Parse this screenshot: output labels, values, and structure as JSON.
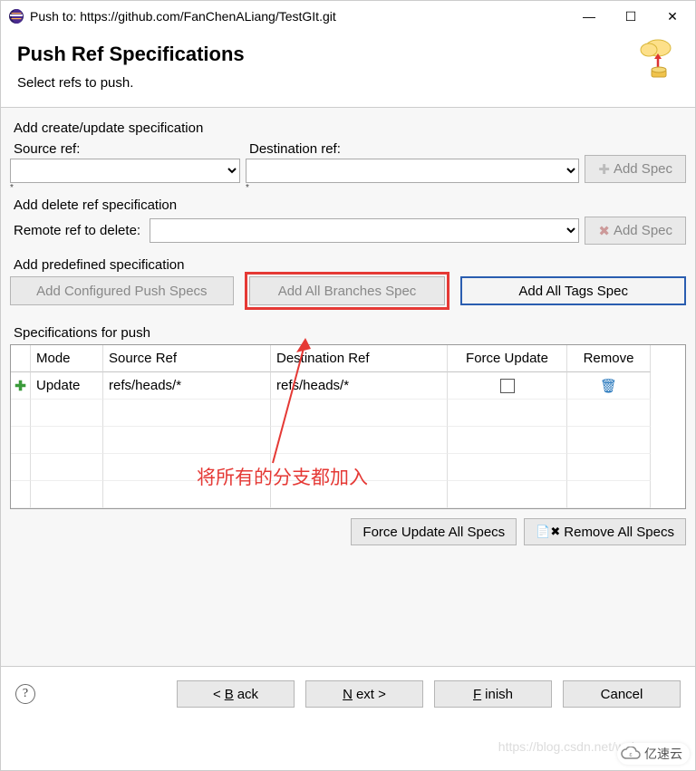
{
  "window": {
    "title": "Push to: https://github.com/FanChenALiang/TestGIt.git"
  },
  "header": {
    "title": "Push Ref Specifications",
    "subtitle": "Select refs to push."
  },
  "sections": {
    "create_update": {
      "label": "Add create/update specification",
      "source_label": "Source ref:",
      "dest_label": "Destination ref:",
      "source_value": "",
      "dest_value": "",
      "add_btn": "Add Spec"
    },
    "delete": {
      "label": "Add delete ref specification",
      "remote_label": "Remote ref to delete:",
      "remote_value": "",
      "add_btn": "Add Spec"
    },
    "predefined": {
      "label": "Add predefined specification",
      "configured_btn": "Add Configured Push Specs",
      "all_branches_btn": "Add All Branches Spec",
      "all_tags_btn": "Add All Tags Spec"
    },
    "table": {
      "label": "Specifications for push",
      "headers": {
        "mode": "Mode",
        "source": "Source Ref",
        "dest": "Destination Ref",
        "force": "Force Update",
        "remove": "Remove"
      },
      "rows": [
        {
          "mode": "Update",
          "source": "refs/heads/*",
          "dest": "refs/heads/*",
          "force": false
        }
      ],
      "force_all_btn": "Force Update All Specs",
      "remove_all_btn": "Remove All Specs"
    }
  },
  "footer": {
    "help_tooltip": "Help",
    "back_pre": "< ",
    "back_letter": "B",
    "back_suf": "ack",
    "next_letter": "N",
    "next_suf": "ext >",
    "finish_letter": "F",
    "finish_suf": "inish",
    "cancel": "Cancel"
  },
  "annotation": {
    "text": "将所有的分支都加入"
  },
  "watermark": {
    "blog": "https://blog.csdn.net/weix",
    "brand": "亿速云"
  },
  "icons": {
    "minimize": "—",
    "maximize": "☐",
    "close": "✕",
    "trash": "🗑",
    "plus": "✚",
    "delete_x": "✖",
    "doc": "📄"
  }
}
